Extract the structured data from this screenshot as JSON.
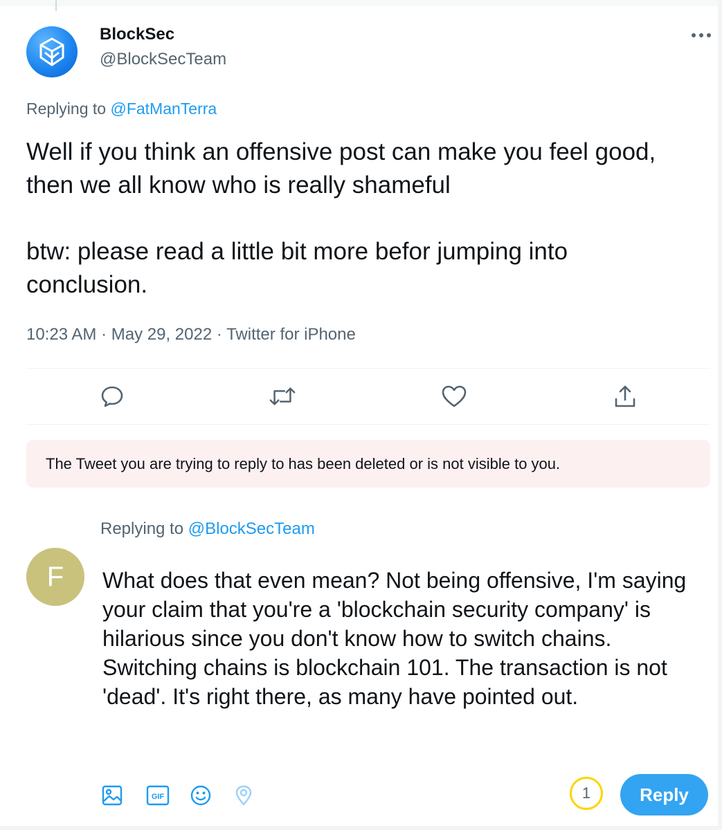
{
  "tweet": {
    "author": {
      "display_name": "BlockSec",
      "handle": "@BlockSecTeam"
    },
    "replying_label": "Replying to",
    "replying_to": "@FatManTerra",
    "paragraphs": [
      "Well if you think an offensive post can make you feel good, then we all know who is really shameful",
      "btw: please read a little bit more befor jumping into conclusion."
    ],
    "time": "10:23 AM",
    "date": "May 29, 2022",
    "source": "Twitter for iPhone",
    "separator": "·",
    "icons": [
      "more-icon",
      "reply-icon",
      "retweet-icon",
      "like-icon",
      "share-icon"
    ]
  },
  "notice": {
    "text": "The Tweet you are trying to reply to has been deleted or is not visible to you."
  },
  "reply_draft": {
    "replying_label": "Replying to",
    "replying_to": "@BlockSecTeam",
    "avatar_letter": "F",
    "text": "What does that even mean? Not being offensive, I'm saying your claim that you're a 'blockchain security company' is hilarious since you don't know how to switch chains. Switching chains is blockchain 101. The transaction is not 'dead'. It's right there, as many have pointed out.",
    "char_counter": "1",
    "reply_button_label": "Reply",
    "tools": [
      "image-icon",
      "gif-icon",
      "emoji-icon",
      "location-icon"
    ]
  },
  "colors": {
    "accent": "#1d9bf0",
    "notice_bg": "#fdf0f1",
    "avatar_f": "#c9c27d",
    "counter_ring": "#ffd400"
  }
}
